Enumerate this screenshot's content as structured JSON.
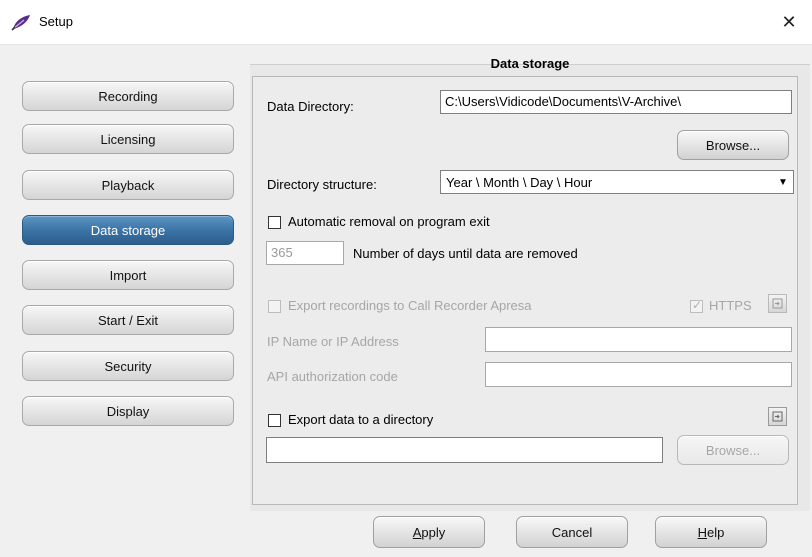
{
  "window": {
    "title": "Setup",
    "close": "✕"
  },
  "nav": {
    "items": [
      {
        "label": "Recording",
        "active": false
      },
      {
        "label": "Licensing",
        "active": false
      },
      {
        "label": "Playback",
        "active": false
      },
      {
        "label": "Data storage",
        "active": true
      },
      {
        "label": "Import",
        "active": false
      },
      {
        "label": "Start / Exit",
        "active": false
      },
      {
        "label": "Security",
        "active": false
      },
      {
        "label": "Display",
        "active": false
      }
    ]
  },
  "panel": {
    "title": "Data storage",
    "data_directory": {
      "label": "Data Directory:",
      "value": "C:\\Users\\Vidicode\\Documents\\V-Archive\\"
    },
    "browse_label": "Browse...",
    "directory_structure": {
      "label": "Directory structure:",
      "value": "Year \\ Month \\ Day \\ Hour",
      "arrow": "▼"
    },
    "auto_removal": {
      "label": "Automatic removal on program exit",
      "checked": false
    },
    "days": {
      "value": "365",
      "label": "Number of days until data are removed"
    },
    "export_apresa": {
      "label": "Export recordings to Call Recorder Apresa",
      "checked": false,
      "enabled": false
    },
    "https": {
      "label": "HTTPS",
      "checked": true,
      "check_mark": "✓",
      "enabled": false
    },
    "ip_name": {
      "label": "IP Name or IP Address",
      "value": ""
    },
    "api_code": {
      "label": "API authorization code",
      "value": ""
    },
    "export_dir": {
      "label": "Export data to a directory",
      "checked": false
    },
    "export_path": {
      "value": ""
    },
    "browse2_label": "Browse..."
  },
  "footer": {
    "apply_prefix": "A",
    "apply_rest": "pply",
    "cancel": "Cancel",
    "help_prefix": "H",
    "help_rest": "elp"
  },
  "colors": {
    "active_nav": "#3b74a6",
    "panel_bg": "#e8e8e8",
    "disabled_text": "#a6a6a6"
  }
}
